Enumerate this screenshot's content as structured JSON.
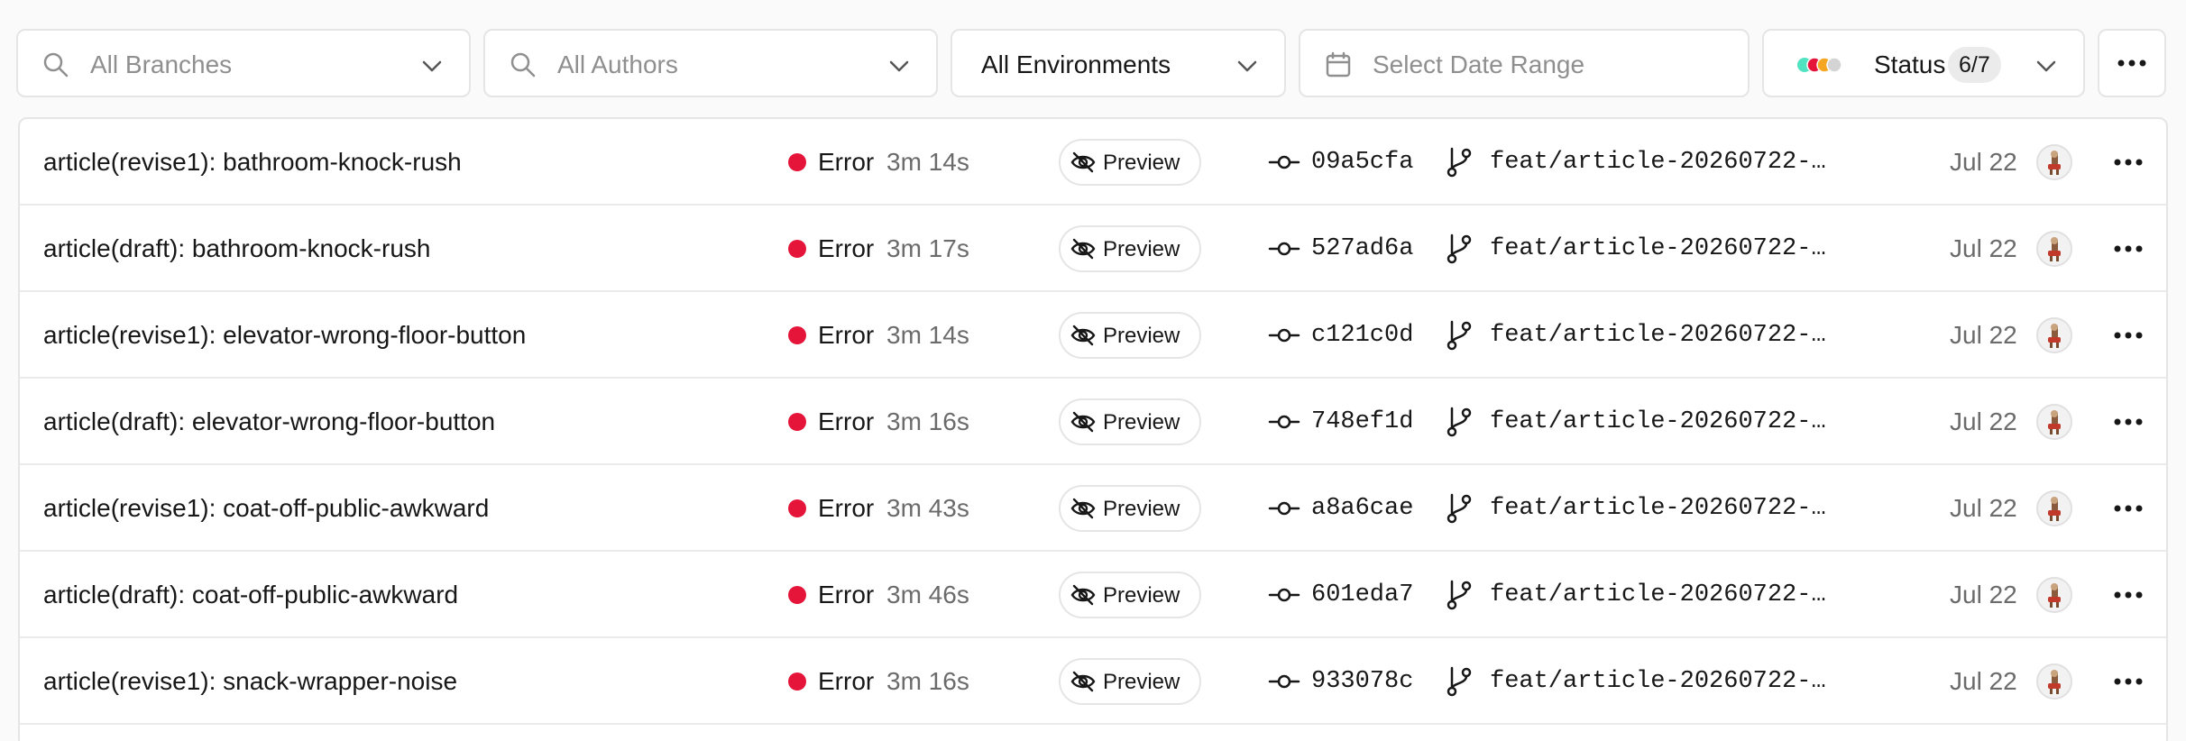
{
  "filters": {
    "branches": {
      "placeholder": "All Branches"
    },
    "authors": {
      "placeholder": "All Authors"
    },
    "environment": {
      "value": "All Environments"
    },
    "date_range": {
      "placeholder": "Select Date Range"
    },
    "status": {
      "label": "Status",
      "count": "6/7",
      "dot_colors": [
        "#50e3c2",
        "#e5153a",
        "#f5a623",
        "#d4d4d4"
      ]
    }
  },
  "colors": {
    "error": "#e5153a",
    "border": "#e5e5e5"
  },
  "deployments": [
    {
      "title": "article(revise1): bathroom-knock-rush",
      "status": "Error",
      "duration": "3m 14s",
      "preview_label": "Preview",
      "commit": "09a5cfa",
      "branch": "feat/article-20260722-…",
      "date": "Jul 22"
    },
    {
      "title": "article(draft): bathroom-knock-rush",
      "status": "Error",
      "duration": "3m 17s",
      "preview_label": "Preview",
      "commit": "527ad6a",
      "branch": "feat/article-20260722-…",
      "date": "Jul 22"
    },
    {
      "title": "article(revise1): elevator-wrong-floor-button",
      "status": "Error",
      "duration": "3m 14s",
      "preview_label": "Preview",
      "commit": "c121c0d",
      "branch": "feat/article-20260722-…",
      "date": "Jul 22"
    },
    {
      "title": "article(draft): elevator-wrong-floor-button",
      "status": "Error",
      "duration": "3m 16s",
      "preview_label": "Preview",
      "commit": "748ef1d",
      "branch": "feat/article-20260722-…",
      "date": "Jul 22"
    },
    {
      "title": "article(revise1): coat-off-public-awkward",
      "status": "Error",
      "duration": "3m 43s",
      "preview_label": "Preview",
      "commit": "a8a6cae",
      "branch": "feat/article-20260722-…",
      "date": "Jul 22"
    },
    {
      "title": "article(draft): coat-off-public-awkward",
      "status": "Error",
      "duration": "3m 46s",
      "preview_label": "Preview",
      "commit": "601eda7",
      "branch": "feat/article-20260722-…",
      "date": "Jul 22"
    },
    {
      "title": "article(revise1): snack-wrapper-noise",
      "status": "Error",
      "duration": "3m 16s",
      "preview_label": "Preview",
      "commit": "933078c",
      "branch": "feat/article-20260722-…",
      "date": "Jul 22"
    }
  ]
}
